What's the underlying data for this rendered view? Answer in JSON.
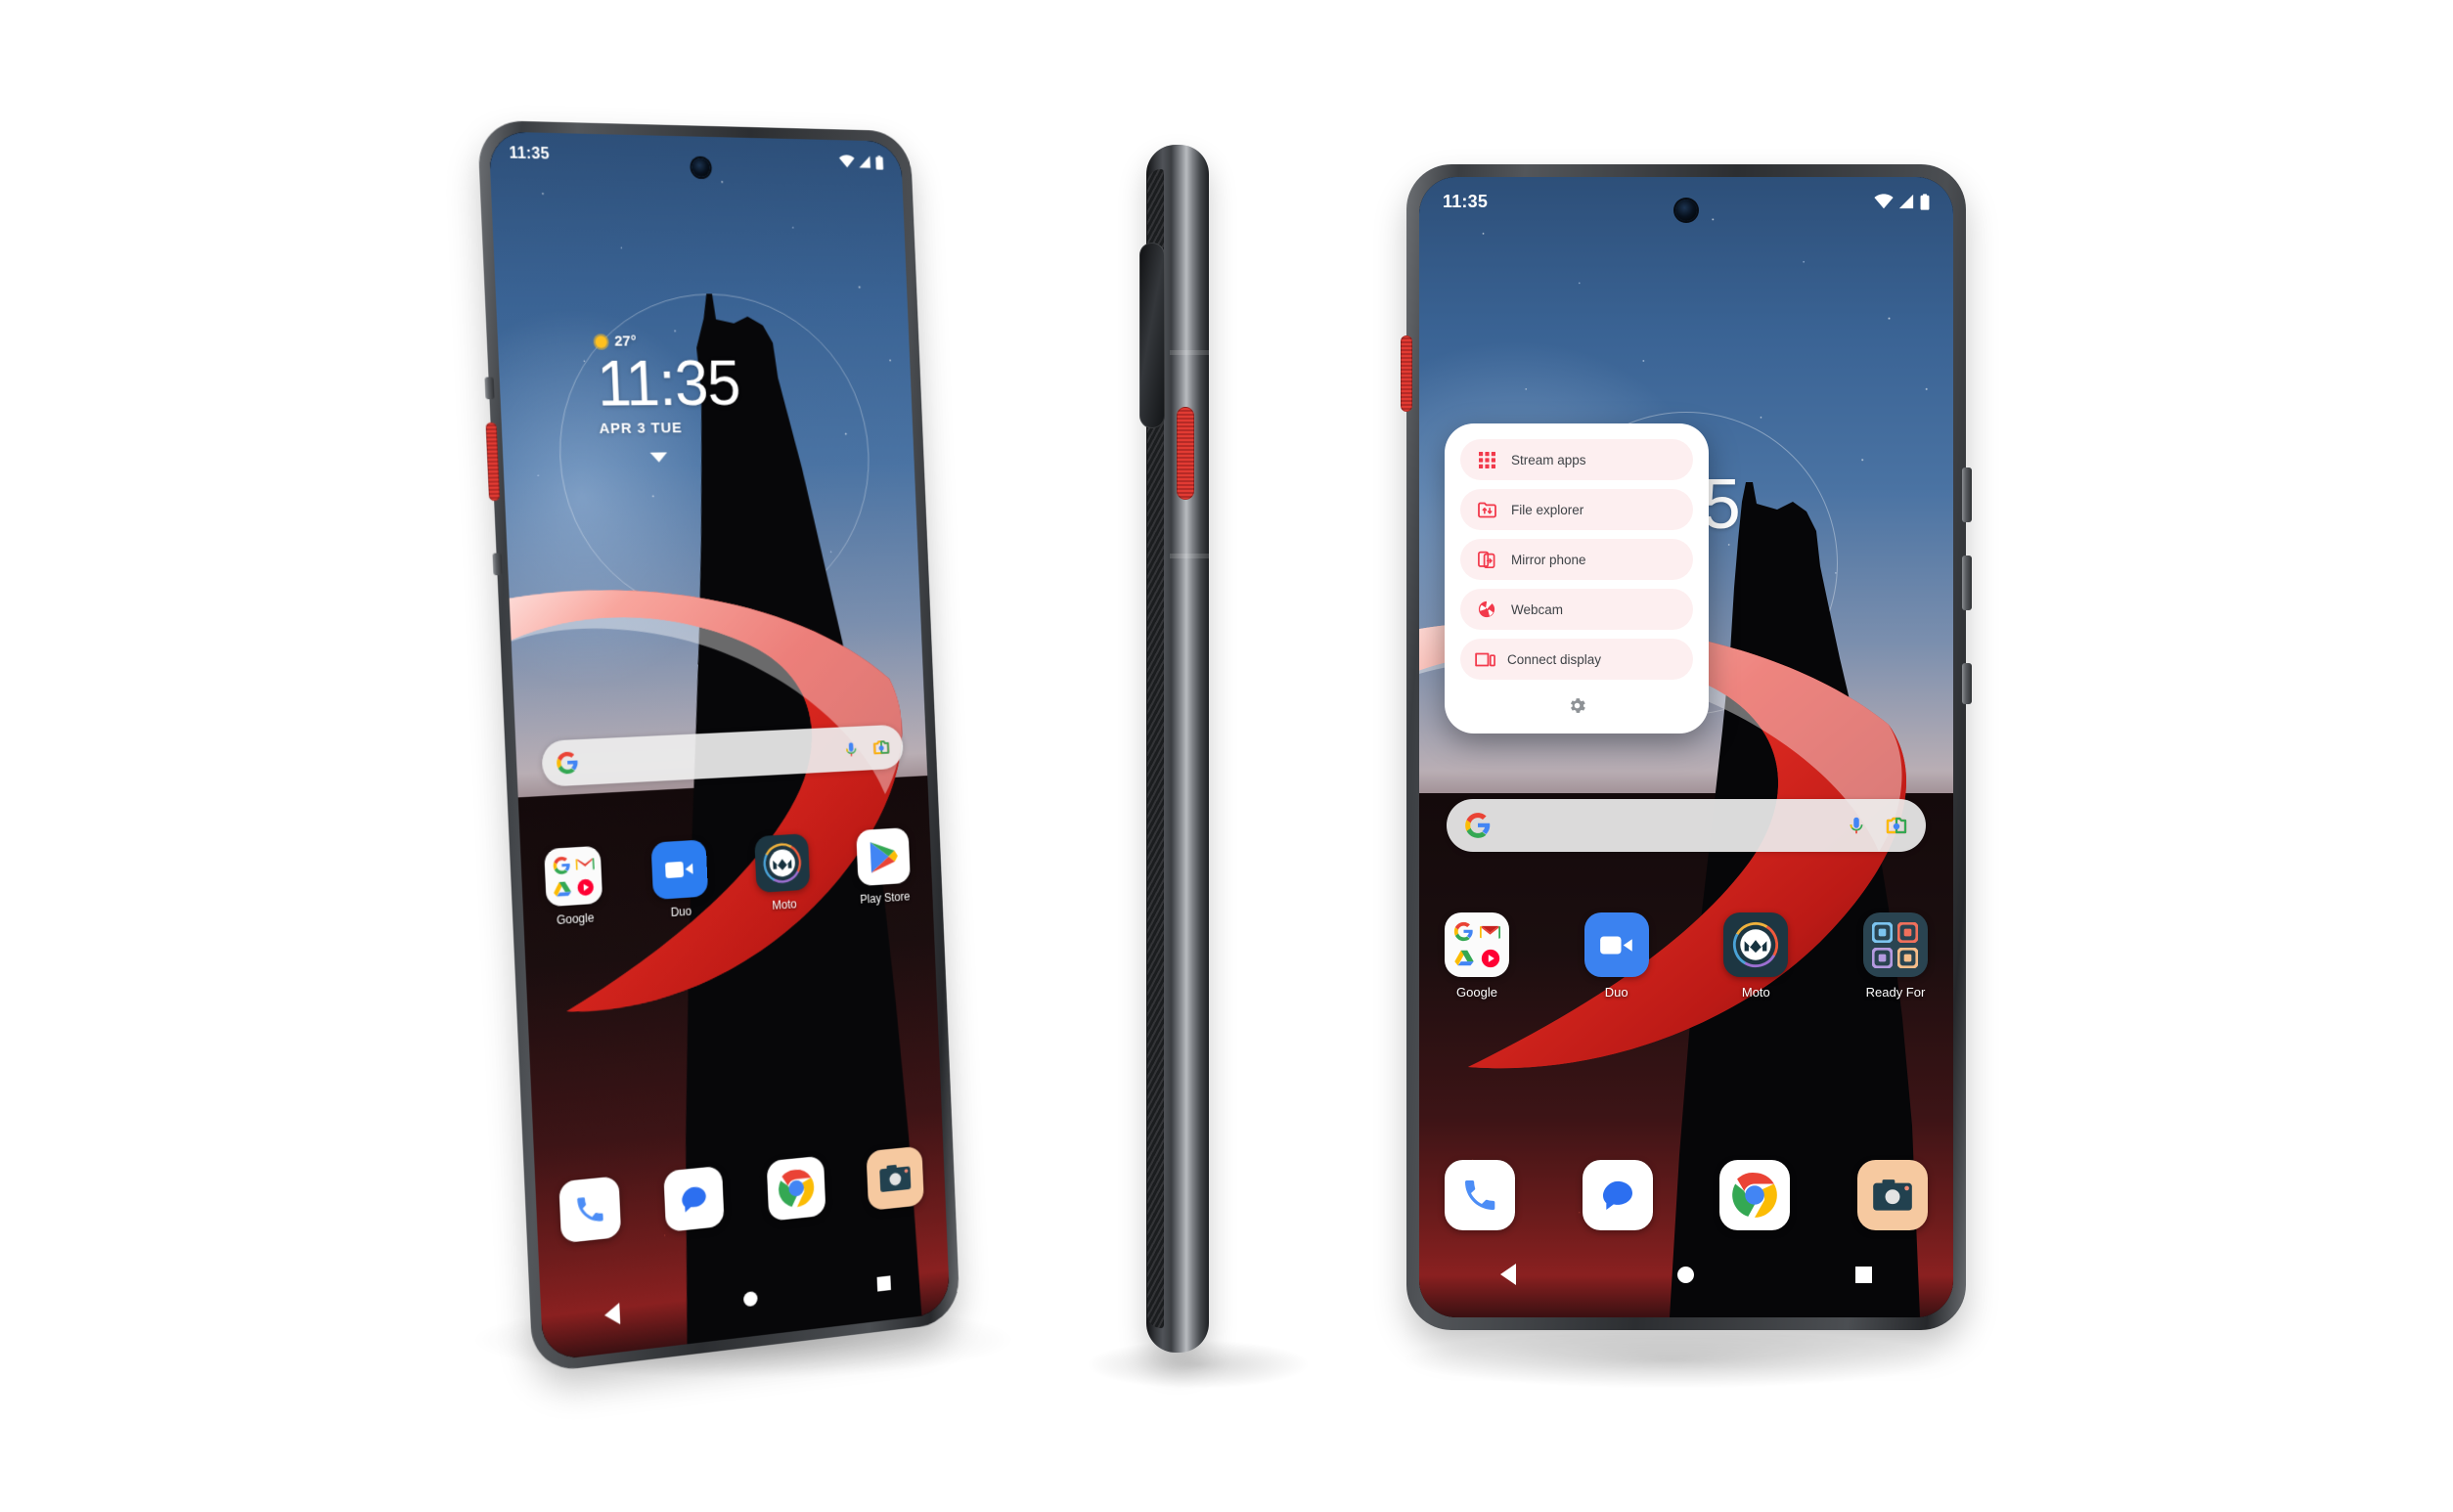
{
  "scene": {
    "title": "Motorola smartphone product render trio",
    "background_color": "#ffffff",
    "devices": [
      {
        "name": "phone-left-front-angled",
        "view": "front three-quarter"
      },
      {
        "name": "phone-center-side",
        "view": "side profile"
      },
      {
        "name": "phone-right-front",
        "view": "front flat with Ready For panel open"
      }
    ]
  },
  "status_bar": {
    "time": "11:35",
    "icons": [
      "wifi-icon",
      "cellular-signal-icon",
      "battery-icon"
    ]
  },
  "clock_widget": {
    "weather_icon": "sun-icon",
    "temperature": "27°",
    "time": "11:35",
    "date": "APR 3 TUE",
    "expand_icon": "caret-down-icon"
  },
  "search_bar": {
    "logo": "google-g-icon",
    "placeholder": "",
    "mic_icon": "microphone-icon",
    "lens_icon": "google-lens-icon"
  },
  "home_screen": {
    "apps_left": [
      {
        "label": "Google",
        "icon": "google-folder-icon"
      },
      {
        "label": "Duo",
        "icon": "duo-video-icon"
      },
      {
        "label": "Moto",
        "icon": "moto-logo-icon"
      },
      {
        "label": "Play Store",
        "icon": "play-store-icon"
      }
    ],
    "apps_right": [
      {
        "label": "Google",
        "icon": "google-folder-icon"
      },
      {
        "label": "Duo",
        "icon": "duo-video-icon"
      },
      {
        "label": "Moto",
        "icon": "moto-logo-icon"
      },
      {
        "label": "Ready For",
        "icon": "ready-for-folder-icon"
      }
    ],
    "dock": [
      {
        "label": "Phone",
        "icon": "phone-handset-icon"
      },
      {
        "label": "Messages",
        "icon": "message-bubble-icon"
      },
      {
        "label": "Chrome",
        "icon": "chrome-icon"
      },
      {
        "label": "Camera",
        "icon": "camera-icon"
      }
    ],
    "nav_bar": [
      "back-icon",
      "home-icon",
      "recents-icon"
    ]
  },
  "ready_for_panel": {
    "items": [
      {
        "label": "Stream apps",
        "icon": "app-grid-icon"
      },
      {
        "label": "File explorer",
        "icon": "folder-transfer-icon"
      },
      {
        "label": "Mirror phone",
        "icon": "mirror-phone-icon"
      },
      {
        "label": "Webcam",
        "icon": "webcam-aperture-icon"
      },
      {
        "label": "Connect display",
        "icon": "connect-display-icon"
      }
    ],
    "settings_icon": "gear-icon"
  },
  "colors": {
    "accent_red": "#F2394B",
    "item_bg": "#FDEFF0",
    "panel_bg": "#FFFFFF",
    "label_text": "#3F4347",
    "power_button_red": "#D6352E",
    "wallpaper_sky": "#3A6394",
    "wallpaper_ground": "#6E1C1C"
  }
}
